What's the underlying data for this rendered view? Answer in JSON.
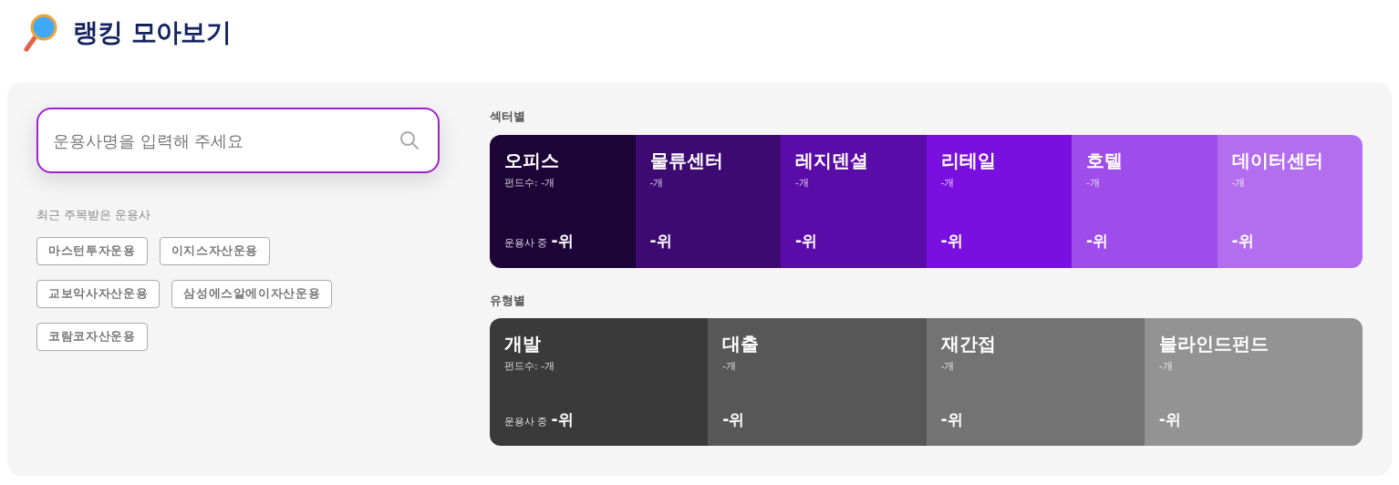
{
  "title": "랭킹 모아보기",
  "search": {
    "placeholder": "운용사명을 입력해 주세요"
  },
  "recent": {
    "label": "최근 주목받은 운용사",
    "tags": [
      "마스턴투자운용",
      "이지스자산운용",
      "교보악사자산운용",
      "삼성에스알에이자산운용",
      "코람코자산운용"
    ]
  },
  "groups": [
    {
      "label": "섹터별",
      "cards": [
        {
          "name": "오피스",
          "count": "펀드수: -개",
          "rank_prefix": "운용사 중",
          "rank": "-위",
          "color": "#1e0538"
        },
        {
          "name": "물류센터",
          "count": "-개",
          "rank": "-위",
          "color": "#3d0a72"
        },
        {
          "name": "레지덴셜",
          "count": "-개",
          "rank": "-위",
          "color": "#5a0ca8"
        },
        {
          "name": "리테일",
          "count": "-개",
          "rank": "-위",
          "color": "#7a10e0"
        },
        {
          "name": "호텔",
          "count": "-개",
          "rank": "-위",
          "color": "#9e4cea"
        },
        {
          "name": "데이터센터",
          "count": "-개",
          "rank": "-위",
          "color": "#b36ef0"
        }
      ]
    },
    {
      "label": "유형별",
      "cards": [
        {
          "name": "개발",
          "count": "펀드수: -개",
          "rank_prefix": "운용사 중",
          "rank": "-위",
          "color": "#3a3a3a"
        },
        {
          "name": "대출",
          "count": "-개",
          "rank": "-위",
          "color": "#575757"
        },
        {
          "name": "재간접",
          "count": "-개",
          "rank": "-위",
          "color": "#737373"
        },
        {
          "name": "블라인드펀드",
          "count": "-개",
          "rank": "-위",
          "color": "#939393"
        }
      ]
    }
  ]
}
